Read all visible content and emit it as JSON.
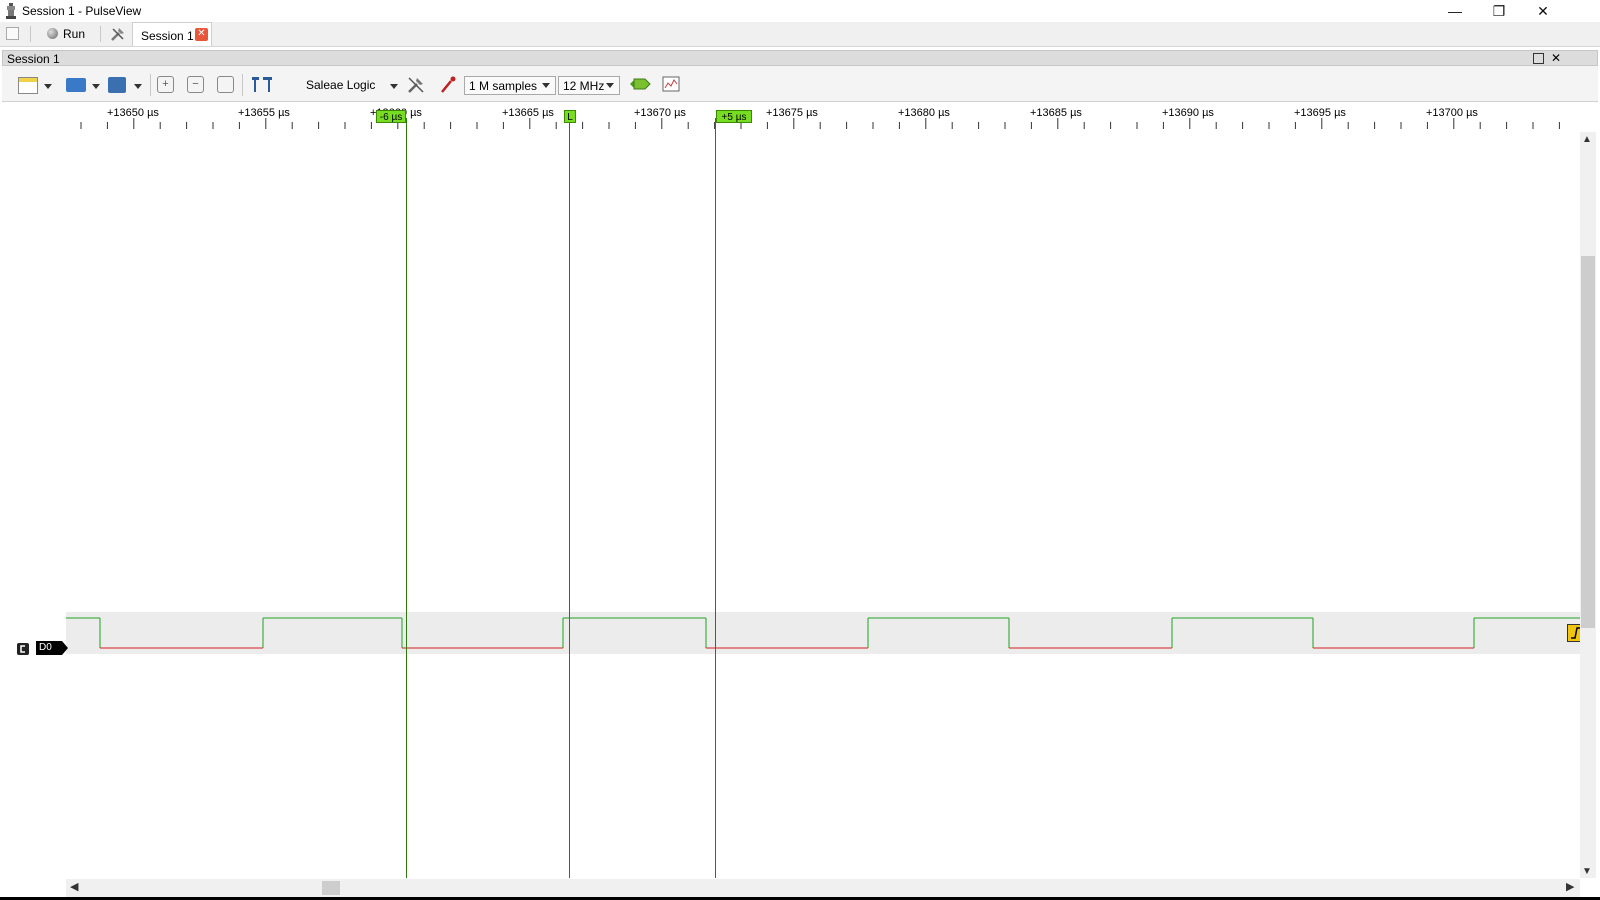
{
  "window": {
    "title": "Session 1 - PulseView",
    "minimize": "—",
    "restore": "❐",
    "close": "✕"
  },
  "tabbar": {
    "run_label": "Run",
    "session_tab": "Session 1",
    "close_tab": "✕"
  },
  "session_panel": {
    "label": "Session 1"
  },
  "toolbar": {
    "device": "Saleae Logic",
    "samples": "1 M samples",
    "rate": "12 MHz"
  },
  "ruler": {
    "ticks": [
      "+13650 µs",
      "+13655 µs",
      "+13660 µs",
      "+13665 µs",
      "+13670 µs",
      "+13675 µs",
      "+13680 µs",
      "+13685 µs",
      "+13690 µs",
      "+13695 µs",
      "+13700 µs"
    ],
    "cursors": [
      {
        "label": "-6 µs"
      },
      {
        "label": "L"
      },
      {
        "label": "+5 µs"
      }
    ]
  },
  "channels": [
    {
      "name": "D0"
    }
  ],
  "colors": {
    "high": "#1fa01f",
    "low": "#d62020",
    "cursor": "#2d7a10",
    "cursor_flag": "#77dd22"
  }
}
